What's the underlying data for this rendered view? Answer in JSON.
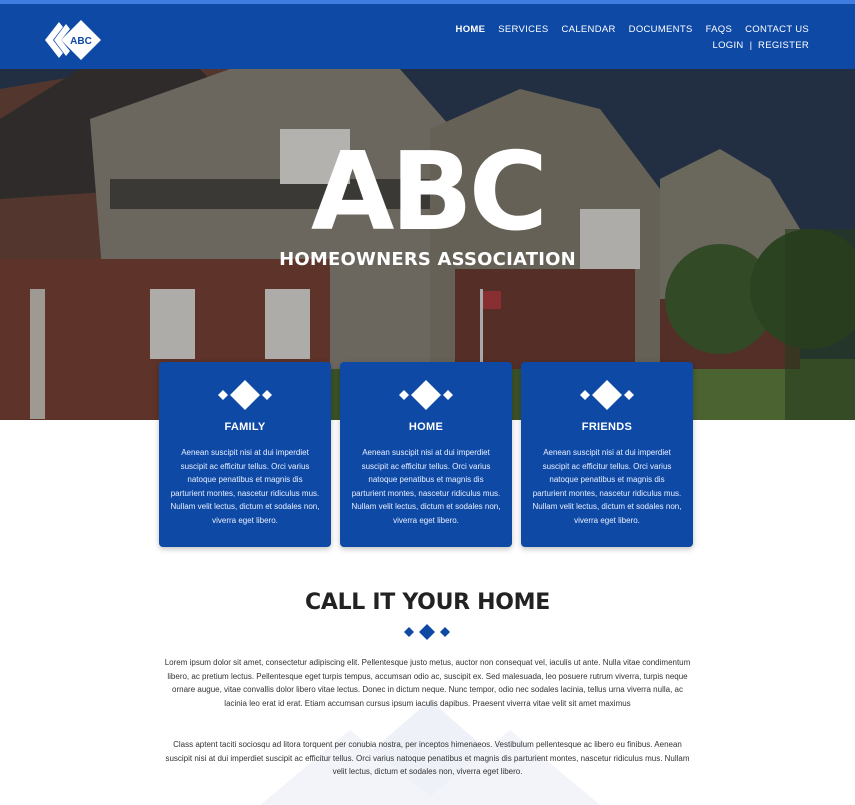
{
  "brand": {
    "logo_text": "ABC"
  },
  "nav": {
    "primary": [
      {
        "label": "HOME",
        "active": true
      },
      {
        "label": "SERVICES",
        "active": false
      },
      {
        "label": "CALENDAR",
        "active": false
      },
      {
        "label": "DOCUMENTS",
        "active": false
      },
      {
        "label": "FAQS",
        "active": false
      },
      {
        "label": "CONTACT US",
        "active": false
      }
    ],
    "account": {
      "login": "LOGIN",
      "separator": "|",
      "register": "REGISTER"
    }
  },
  "hero": {
    "title": "ABC",
    "subtitle": "HOMEOWNERS ASSOCIATION"
  },
  "cards": [
    {
      "title": "FAMILY",
      "text": "Aenean suscipit nisi at dui imperdiet suscipit ac efficitur tellus. Orci varius natoque penatibus et magnis dis parturient montes, nascetur ridiculus mus. Nullam velit lectus, dictum et sodales non, viverra eget libero."
    },
    {
      "title": "HOME",
      "text": "Aenean suscipit nisi at dui imperdiet suscipit ac efficitur tellus. Orci varius natoque penatibus et magnis dis parturient montes, nascetur ridiculus mus. Nullam velit lectus, dictum et sodales non, viverra eget libero."
    },
    {
      "title": "FRIENDS",
      "text": "Aenean suscipit nisi at dui imperdiet suscipit ac efficitur tellus. Orci varius natoque penatibus et magnis dis parturient montes, nascetur ridiculus mus. Nullam velit lectus, dictum et sodales non, viverra eget libero."
    }
  ],
  "about": {
    "title": "CALL IT YOUR HOME",
    "paragraphs": [
      "Lorem ipsum dolor sit amet, consectetur adipiscing elit. Pellentesque justo metus, auctor non consequat vel, iaculis ut ante. Nulla vitae condimentum libero, ac pretium lectus. Pellentesque eget turpis tempus, accumsan odio ac, suscipit ex. Sed malesuada, leo posuere rutrum viverra, turpis neque ornare augue, vitae convallis dolor libero vitae lectus. Donec in dictum neque. Nunc tempor, odio nec sodales lacinia, tellus urna viverra nulla, ac lacinia leo erat id erat. Etiam accumsan cursus ipsum iaculis dapibus. Praesent viverra vitae velit sit amet maximus",
      "Class aptent taciti sociosqu ad litora torquent per conubia nostra, per inceptos himenaeos. Vestibulum pellentesque ac libero eu finibus. Aenean suscipit nisi at dui imperdiet suscipit ac efficitur tellus. Orci varius natoque penatibus et magnis dis parturient montes, nascetur ridiculus mus. Nullam velit lectus, dictum et sodales non, viverra eget libero."
    ]
  },
  "colors": {
    "brand_blue": "#0e49a6",
    "accent_blue": "#3f7ee0",
    "heading": "#222222",
    "body_text": "#333333"
  },
  "icons": {
    "logo": "abc-diamond-logo-icon",
    "card": "three-diamonds-icon",
    "divider": "three-diamonds-divider-icon"
  }
}
